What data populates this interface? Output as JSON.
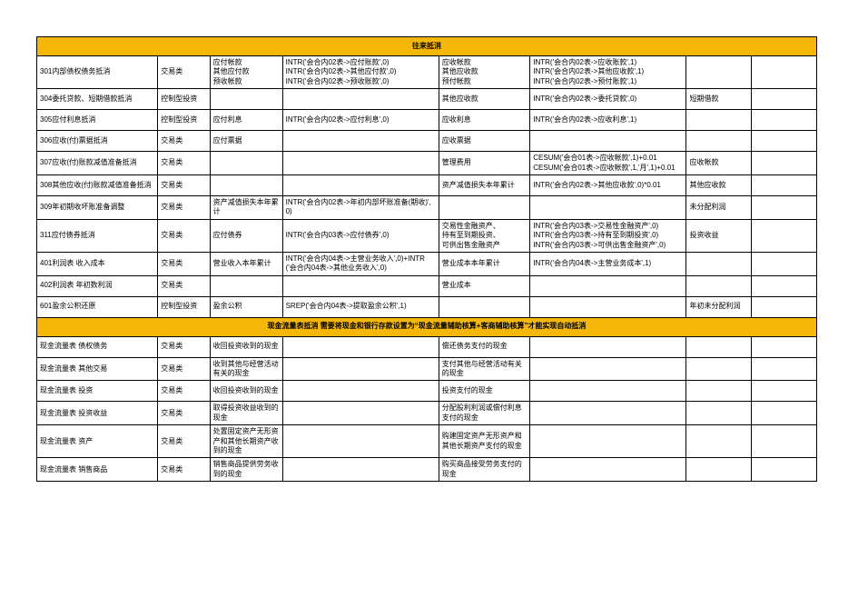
{
  "section1_title": "往来抵消",
  "section2_title": "现金流量表抵消  需要将现金和银行存款设置为“现金流量辅助核算+客商辅助核算”才能实现自动抵消",
  "rows1": [
    {
      "a": "301内部债权债务抵消",
      "b": "交易类",
      "c": "应付帐款\n其他应付款\n预收帐款",
      "d": "INTR('会合内02表->应付账款',0)\nINTR('会合内02表->其他应付款',0)\nINTR('会合内02表->预收账款',0)",
      "e": "应收帐款\n其他应收款\n预付帐款",
      "f": "INTR('会合内02表->应收账款',1)\nINTR('会合内02表->其他应收款',1)\nINTR('会合内02表->预付账款',1)",
      "g": "",
      "h": ""
    },
    {
      "a": "304委托贷款、短期借款抵消",
      "b": "控制型投资",
      "c": "",
      "d": "",
      "e": "其他应收款",
      "f": "INTR('会合内02表->委托贷款',0)",
      "g": "短期借款",
      "h": ""
    },
    {
      "a": "305应付利息抵消",
      "b": "控制型投资",
      "c": "应付利息",
      "d": "INTR('会合内02表->应付利息',0)",
      "e": "应收利息",
      "f": "INTR('会合内02表->应收利息',1)",
      "g": "",
      "h": ""
    },
    {
      "a": "306应收(付)票据抵消",
      "b": "交易类",
      "c": "应付票据",
      "d": "",
      "e": "应收票据",
      "f": "",
      "g": "",
      "h": ""
    },
    {
      "a": "307应收(付)账款减值准备抵消",
      "b": "交易类",
      "c": "",
      "d": "",
      "e": "管理费用",
      "f": "CESUM('会合01表->应收帐款',1)+0.01\nCESUM('会合01表->应收帐款',1,'月',1)+0.01",
      "g": "应收帐款",
      "h": ""
    },
    {
      "a": "308其他应收(付)账款减值准备抵消",
      "b": "交易类",
      "c": "",
      "d": "",
      "e": "资产减值损失本年累计",
      "f": "INTR('会合内02表->其他应收款',0)*0.01",
      "g": "其他应收款",
      "h": ""
    },
    {
      "a": "309年初期收坏账准备调整",
      "b": "交易类",
      "c": "资产减值损失本年累计",
      "d": "INTR('会合内02表->年初内部坏账准备(期收)',0)",
      "e": "",
      "f": "",
      "g": "未分配利润",
      "h": ""
    },
    {
      "a": "311应付债券抵消",
      "b": "交易类",
      "c": "应付债券",
      "d": "INTR('会合内03表->应付债券',0)",
      "e": "交易性金融资产、\n持有至到期投资、\n可供出售金融资产",
      "f": "INTR('会合内03表->交易性金融资产',0)\nINTR('会合内03表->持有至到期投资',0)\nINTR('会合内03表->可供出售金融资产',0)",
      "g": "投资收益",
      "h": ""
    },
    {
      "a": "401利润表 收入成本",
      "b": "交易类",
      "c": "营业收入本年累计",
      "d": "INTR('会合内04表->主营业务收入',0)+INTR('会合内04表->其他业务收入',0)",
      "e": "营业成本本年累计",
      "f": "INTR('会合内04表->主营业务成本',1)",
      "g": "",
      "h": ""
    },
    {
      "a": "402利润表 年初数利润",
      "b": "交易类",
      "c": "",
      "d": "",
      "e": "营业成本",
      "f": "",
      "g": "",
      "h": ""
    },
    {
      "a": "601盈余公积还原",
      "b": "控制型投资",
      "c": "盈余公积",
      "d": "SREP('会合内04表->提取盈余公积',1)",
      "e": "",
      "f": "",
      "g": "年初未分配利润",
      "h": ""
    }
  ],
  "rows2": [
    {
      "a": "现金流量表 债权债务",
      "b": "交易类",
      "c": "收回投资收到的现金",
      "d": "",
      "e": "偿还债务支付的现金",
      "f": "",
      "g": "",
      "h": ""
    },
    {
      "a": "现金流量表 其他交易",
      "b": "交易类",
      "c": "收到其他与经营活动有关的现金",
      "d": "",
      "e": "支付其他与经营活动有关的现金",
      "f": "",
      "g": "",
      "h": ""
    },
    {
      "a": "现金流量表 投资",
      "b": "交易类",
      "c": "收回投资收到的现金",
      "d": "",
      "e": "投资支付的现金",
      "f": "",
      "g": "",
      "h": ""
    },
    {
      "a": "现金流量表 投资收益",
      "b": "交易类",
      "c": "取得投资收益收到的现金",
      "d": "",
      "e": "分配股利利润或偿付利息支付的现金",
      "f": "",
      "g": "",
      "h": ""
    },
    {
      "a": "现金流量表 资产",
      "b": "交易类",
      "c": "处置固定资产无形资产和其他长期资产收到的现金",
      "d": "",
      "e": "购建固定资产无形资产和其他长期资产支付的现金",
      "f": "",
      "g": "",
      "h": ""
    },
    {
      "a": "现金流量表 销售商品",
      "b": "交易类",
      "c": "销售商品提供劳务收到的现金",
      "d": "",
      "e": "购买商品接受劳务支付的现金",
      "f": "",
      "g": "",
      "h": ""
    }
  ]
}
